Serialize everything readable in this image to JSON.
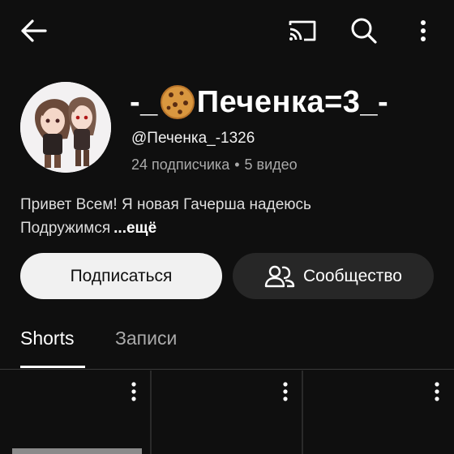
{
  "channel": {
    "name_prefix": "-_",
    "name_suffix": "Печенка=3_-",
    "handle": "@Печенка_-1326",
    "subscribers": "24 подписчика",
    "separator": "•",
    "videos": "5 видео",
    "bio_line1": "Привет Всем! Я новая Гачерша надеюсь",
    "bio_line2": "Подружимся",
    "more_label": "...ещё"
  },
  "actions": {
    "subscribe_label": "Подписаться",
    "community_label": "Сообщество"
  },
  "tabs": [
    {
      "label": "Shorts",
      "active": true
    },
    {
      "label": "Записи",
      "active": false
    }
  ],
  "icons": {
    "back": "arrow-back-icon",
    "cast": "cast-icon",
    "search": "search-icon",
    "more": "more-vert-icon",
    "community": "people-icon",
    "cookie": "cookie-emoji"
  },
  "colors": {
    "background": "#0f0f0f",
    "subscribe_bg": "#f1f1f1",
    "community_bg": "#272727",
    "secondary_text": "#aaaaaa"
  }
}
